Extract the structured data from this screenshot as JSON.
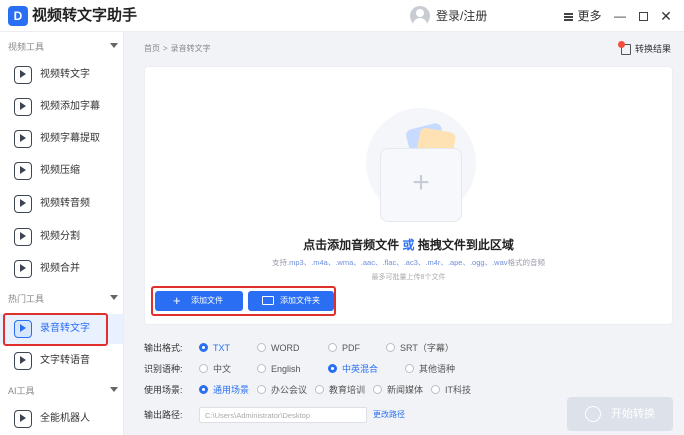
{
  "app": {
    "logo_letter": "D",
    "title": "视频转文字助手",
    "login": "登录/注册",
    "more": "更多",
    "minimize": "—",
    "close": "✕"
  },
  "sidebar": {
    "sections": [
      {
        "title": "视频工具",
        "items": [
          {
            "label": "视频转文字"
          },
          {
            "label": "视频添加字幕"
          },
          {
            "label": "视频字幕提取"
          },
          {
            "label": "视频压缩"
          },
          {
            "label": "视频转音频"
          },
          {
            "label": "视频分割"
          },
          {
            "label": "视频合并"
          }
        ]
      },
      {
        "title": "热门工具",
        "items": [
          {
            "label": "录音转文字",
            "active": true
          },
          {
            "label": "文字转语音"
          }
        ]
      },
      {
        "title": "AI工具",
        "items": [
          {
            "label": "全能机器人"
          }
        ]
      }
    ]
  },
  "breadcrumb": {
    "home": "首页",
    "sep": ">",
    "current": "录音转文字"
  },
  "result": {
    "label": "转换结果"
  },
  "dropzone": {
    "title_a": "点击添加音频文件",
    "title_or": "或",
    "title_b": "拖拽文件到此区域",
    "formats_prefix": "支持",
    "formats": ".mp3、.m4a、.wma、.aac、.flac、.ac3、.m4r、.ape、.ogg、.wav",
    "formats_suffix": "格式的音频",
    "limit": "最多可批量上传8个文件",
    "add_file": "添加文件",
    "add_folder": "添加文件夹"
  },
  "options": {
    "format": {
      "label": "输出格式:",
      "choices": [
        "TXT",
        "WORD",
        "PDF",
        "SRT（字幕）"
      ],
      "selected": 0
    },
    "language": {
      "label": "识别语种:",
      "choices": [
        "中文",
        "English",
        "中英混合",
        "其他语种"
      ],
      "selected": 2
    },
    "scene": {
      "label": "使用场景:",
      "choices": [
        "通用场景",
        "办公会议",
        "教育培训",
        "新闻媒体",
        "IT科技"
      ],
      "selected": 0
    },
    "path": {
      "label": "输出路径:",
      "value": "C:\\Users\\Administrator\\Desktop",
      "change": "更改路径"
    }
  },
  "start": {
    "label": "开始转换"
  },
  "colors": {
    "accent": "#2a6ff3",
    "highlight": "#e0302e"
  }
}
